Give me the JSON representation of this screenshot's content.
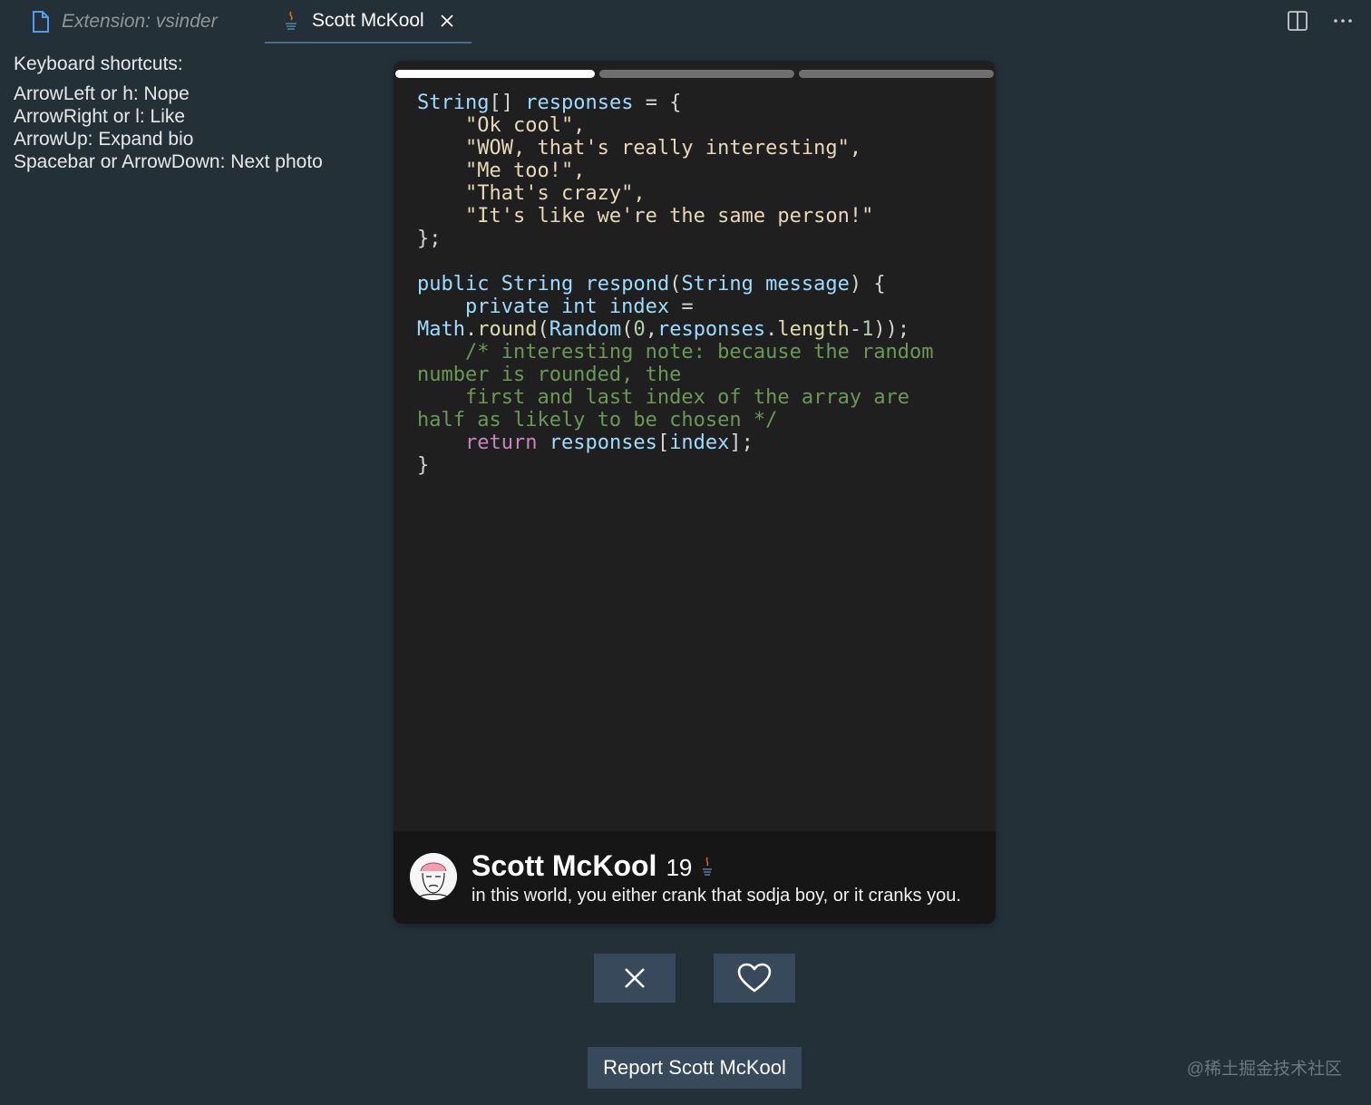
{
  "tabs": {
    "extension_label": "Extension: vsinder",
    "active_label": "Scott McKool"
  },
  "shortcuts": {
    "title": "Keyboard shortcuts:",
    "items": [
      "ArrowLeft or h: Nope",
      "ArrowRight or l: Like",
      "ArrowUp: Expand bio",
      "Spacebar or ArrowDown: Next photo"
    ]
  },
  "card": {
    "photo_count": 3,
    "current_photo": 1,
    "code_lines": [
      "String[] responses = {",
      "    \"Ok cool\",",
      "    \"WOW, that's really interesting\",",
      "    \"Me too!\",",
      "    \"That's crazy\",",
      "    \"It's like we're the same person!\"",
      "};",
      "",
      "public String respond(String message) {",
      "    private int index =",
      "Math.round(Random(0,responses.length-1));",
      "    /* interesting note: because the random",
      "number is rounded, the",
      "    first and last index of the array are",
      "half as likely to be chosen */",
      "    return responses[index];",
      "}"
    ],
    "profile": {
      "name": "Scott McKool",
      "age": "19",
      "bio": "in this world, you either crank that sodja boy, or it cranks you."
    }
  },
  "actions": {
    "report_label": "Report Scott McKool"
  },
  "watermark": "@稀土掘金技术社区",
  "colors": {
    "background": "#243038",
    "card": "#1f1f1f",
    "button": "#37495a",
    "accent_tab_underline": "#4d6b85"
  }
}
